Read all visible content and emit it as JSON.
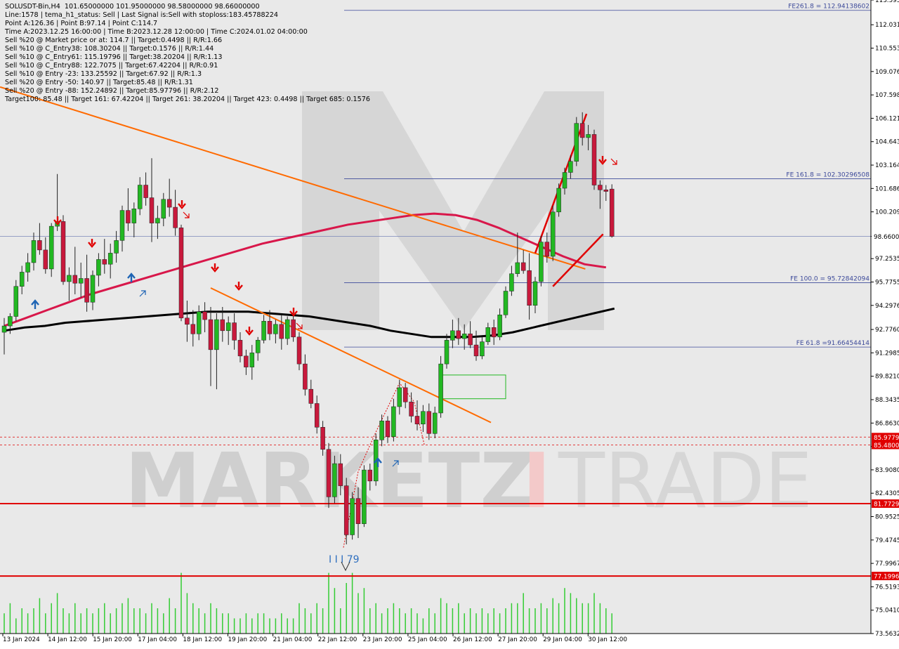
{
  "info": {
    "lines": [
      "SOLUSDT-Bin,H4  101.65000000 101.95000000 98.58000000 98.66000000",
      "Line:1578 | tema_h1_status: Sell | Last Signal is:Sell with stoploss:183.45788224",
      "Point A:126.36 | Point B:97.14 | Point C:114.7",
      "Time A:2023.12.25 16:00:00 | Time B:2023.12.28 12:00:00 | Time C:2024.01.02 04:00:00",
      "Sell %20 @ Market price or at: 114.7 || Target:0.4498 || R/R:1.66",
      "Sell %10 @ C_Entry38: 108.30204 || Target:0.1576 || R/R:1.44",
      "Sell %10 @ C_Entry61: 115.19796 || Target:38.20204 || R/R:1.13",
      "Sell %10 @ C_Entry88: 122.7075 || Target:67.42204 || R/R:0.91",
      "Sell %10 @ Entry -23: 133.25592 || Target:67.92 || R/R:1.3",
      "Sell %20 @ Entry -50: 140.97 || Target:85.48 || R/R:1.31",
      "Sell %20 @ Entry -88: 152.24892 || Target:85.97796 || R/R:2.12",
      "Target100: 85.48 || Target 161: 67.42204 || Target 261: 38.20204 || Target 423: 0.4498 || Target 685: 0.1576"
    ]
  },
  "watermark": {
    "left": "MARKETZ",
    "accent": "I",
    "right": "TRADE"
  },
  "colors": {
    "bull": "#22b822",
    "bear": "#c8193c",
    "wick": "#222222",
    "trend": "#ff6a00",
    "ma_red": "#d8174a",
    "ma_black": "#000000",
    "fib": "#3d4a9a",
    "support": "#e00000",
    "volume": "#33cc33",
    "arrow_sell": "#e00000",
    "arrow_buy": "#1e64b4"
  },
  "chart_data": {
    "type": "candlestick",
    "symbol": "SOLUSDT-Bin",
    "timeframe": "H4",
    "ylim": [
      73.5632,
      113.595
    ],
    "y_ticks": [
      "113.5950",
      "112.0310",
      "110.5535",
      "109.0760",
      "107.5985",
      "106.1210",
      "104.6435",
      "103.1640",
      "101.6865",
      "100.2090",
      "98.6600",
      "97.2535",
      "95.7755",
      "94.2976",
      "92.7760",
      "91.2985",
      "89.8210",
      "88.3435",
      "86.8630",
      "85.3855",
      "83.9080",
      "82.4305",
      "80.9525",
      "79.4745",
      "77.9967",
      "76.5193",
      "75.0410",
      "73.5632"
    ],
    "x_ticks": [
      "13 Jan 2024",
      "14 Jan 12:00",
      "15 Jan 20:00",
      "17 Jan 04:00",
      "18 Jan 12:00",
      "19 Jan 20:00",
      "21 Jan 04:00",
      "22 Jan 12:00",
      "23 Jan 20:00",
      "25 Jan 04:00",
      "26 Jan 12:00",
      "27 Jan 20:00",
      "29 Jan 04:00",
      "30 Jan 12:00"
    ],
    "ohlc": [
      [
        92.6,
        93.5,
        91.2,
        93.0
      ],
      [
        93.0,
        93.8,
        92.5,
        93.6
      ],
      [
        93.6,
        95.9,
        93.3,
        95.5
      ],
      [
        95.5,
        96.8,
        95.0,
        96.4
      ],
      [
        96.4,
        97.6,
        95.8,
        97.0
      ],
      [
        97.0,
        98.9,
        96.5,
        98.4
      ],
      [
        98.4,
        99.5,
        97.5,
        97.8
      ],
      [
        97.8,
        98.6,
        96.3,
        96.6
      ],
      [
        96.6,
        99.5,
        96.1,
        99.3
      ],
      [
        99.3,
        102.6,
        99.0,
        99.6
      ],
      [
        99.6,
        100.0,
        95.6,
        95.8
      ],
      [
        95.8,
        96.7,
        94.6,
        96.2
      ],
      [
        96.2,
        98.0,
        95.0,
        95.7
      ],
      [
        95.7,
        97.0,
        94.8,
        96.0
      ],
      [
        96.0,
        97.5,
        93.9,
        94.5
      ],
      [
        94.5,
        96.5,
        94.0,
        96.2
      ],
      [
        96.2,
        97.6,
        95.5,
        97.2
      ],
      [
        97.2,
        98.5,
        96.3,
        96.9
      ],
      [
        96.9,
        98.2,
        96.0,
        97.6
      ],
      [
        97.6,
        99.0,
        97.0,
        98.4
      ],
      [
        98.4,
        100.6,
        97.7,
        100.3
      ],
      [
        100.3,
        101.7,
        99.0,
        99.5
      ],
      [
        99.5,
        100.8,
        98.6,
        100.4
      ],
      [
        100.4,
        102.4,
        100.0,
        101.9
      ],
      [
        101.9,
        102.7,
        100.6,
        101.1
      ],
      [
        101.1,
        103.6,
        98.3,
        99.5
      ],
      [
        99.5,
        100.6,
        98.5,
        99.8
      ],
      [
        99.8,
        101.4,
        99.3,
        101.0
      ],
      [
        101.0,
        102.3,
        99.9,
        100.5
      ],
      [
        100.5,
        101.6,
        98.7,
        99.2
      ],
      [
        99.2,
        99.4,
        93.3,
        93.5
      ],
      [
        93.5,
        94.6,
        92.0,
        93.1
      ],
      [
        93.1,
        94.0,
        91.7,
        92.5
      ],
      [
        92.5,
        94.3,
        92.1,
        93.9
      ],
      [
        93.9,
        94.5,
        92.6,
        93.4
      ],
      [
        93.4,
        94.2,
        89.2,
        91.5
      ],
      [
        91.5,
        93.8,
        89.0,
        93.4
      ],
      [
        93.4,
        94.2,
        92.0,
        92.7
      ],
      [
        92.7,
        93.6,
        91.8,
        93.2
      ],
      [
        93.2,
        93.8,
        91.5,
        92.1
      ],
      [
        92.1,
        92.6,
        90.7,
        91.1
      ],
      [
        91.1,
        91.5,
        89.9,
        90.4
      ],
      [
        90.4,
        91.8,
        89.6,
        91.3
      ],
      [
        91.3,
        92.3,
        90.8,
        92.1
      ],
      [
        92.1,
        93.7,
        91.9,
        93.3
      ],
      [
        93.3,
        94.0,
        92.1,
        92.5
      ],
      [
        92.5,
        93.4,
        91.9,
        93.1
      ],
      [
        93.1,
        93.7,
        91.5,
        92.2
      ],
      [
        92.2,
        93.6,
        91.8,
        93.4
      ],
      [
        93.4,
        93.8,
        92.0,
        92.3
      ],
      [
        92.3,
        92.6,
        90.2,
        90.6
      ],
      [
        90.6,
        91.2,
        88.6,
        89.0
      ],
      [
        89.0,
        89.6,
        87.8,
        88.1
      ],
      [
        88.1,
        88.6,
        86.2,
        86.6
      ],
      [
        86.6,
        87.0,
        84.8,
        85.2
      ],
      [
        85.2,
        85.6,
        81.5,
        82.2
      ],
      [
        82.2,
        84.8,
        81.8,
        84.3
      ],
      [
        84.3,
        84.9,
        82.3,
        82.9
      ],
      [
        82.9,
        83.4,
        79.2,
        79.8
      ],
      [
        79.8,
        82.5,
        79.5,
        82.1
      ],
      [
        82.1,
        82.8,
        79.6,
        80.5
      ],
      [
        80.5,
        84.2,
        80.3,
        83.9
      ],
      [
        83.9,
        84.3,
        82.6,
        83.2
      ],
      [
        83.2,
        86.2,
        82.9,
        85.8
      ],
      [
        85.8,
        87.4,
        85.4,
        87.0
      ],
      [
        87.0,
        87.3,
        85.6,
        86.0
      ],
      [
        86.0,
        88.4,
        85.7,
        87.9
      ],
      [
        87.9,
        89.6,
        87.4,
        89.1
      ],
      [
        89.1,
        89.4,
        87.8,
        88.2
      ],
      [
        88.2,
        88.8,
        86.9,
        87.3
      ],
      [
        87.3,
        88.3,
        86.4,
        86.8
      ],
      [
        86.8,
        88.0,
        86.3,
        87.6
      ],
      [
        87.6,
        88.1,
        85.8,
        86.2
      ],
      [
        86.2,
        87.9,
        85.9,
        87.5
      ],
      [
        87.5,
        91.1,
        87.2,
        90.6
      ],
      [
        90.6,
        92.5,
        90.3,
        92.1
      ],
      [
        92.1,
        93.4,
        91.6,
        92.7
      ],
      [
        92.7,
        93.5,
        91.8,
        92.2
      ],
      [
        92.2,
        93.1,
        91.5,
        92.5
      ],
      [
        92.5,
        93.3,
        91.6,
        91.8
      ],
      [
        91.8,
        92.7,
        90.8,
        91.1
      ],
      [
        91.1,
        92.3,
        90.9,
        92.0
      ],
      [
        92.0,
        93.2,
        91.8,
        92.9
      ],
      [
        92.9,
        93.4,
        91.8,
        92.3
      ],
      [
        92.3,
        94.1,
        92.1,
        93.7
      ],
      [
        93.7,
        95.5,
        93.5,
        95.2
      ],
      [
        95.2,
        96.8,
        94.9,
        96.3
      ],
      [
        96.3,
        98.9,
        96.1,
        97.0
      ],
      [
        97.0,
        97.8,
        96.3,
        96.5
      ],
      [
        96.5,
        97.6,
        93.4,
        94.3
      ],
      [
        94.3,
        96.1,
        93.8,
        95.8
      ],
      [
        95.8,
        98.7,
        95.5,
        98.3
      ],
      [
        98.3,
        98.9,
        97.0,
        97.4
      ],
      [
        97.4,
        100.6,
        97.1,
        100.2
      ],
      [
        100.2,
        102.0,
        99.9,
        101.7
      ],
      [
        101.7,
        103.0,
        101.3,
        102.7
      ],
      [
        102.7,
        103.8,
        102.3,
        103.4
      ],
      [
        103.4,
        106.2,
        103.1,
        105.8
      ],
      [
        105.8,
        106.5,
        104.4,
        104.9
      ],
      [
        104.9,
        105.7,
        104.1,
        105.1
      ],
      [
        105.1,
        105.4,
        101.6,
        101.9
      ],
      [
        101.9,
        102.2,
        100.4,
        101.6
      ],
      [
        101.6,
        101.9,
        100.9,
        101.5
      ],
      [
        101.65,
        101.95,
        98.58,
        98.66
      ]
    ],
    "volume": [
      4,
      6,
      3,
      5,
      4,
      5,
      7,
      4,
      6,
      8,
      5,
      4,
      6,
      4,
      5,
      4,
      5,
      6,
      4,
      5,
      6,
      7,
      5,
      5,
      4,
      6,
      5,
      4,
      7,
      5,
      12,
      8,
      6,
      5,
      4,
      6,
      5,
      4,
      4,
      3,
      3,
      4,
      3,
      4,
      4,
      3,
      3,
      4,
      3,
      3,
      6,
      5,
      4,
      6,
      5,
      12,
      9,
      5,
      10,
      12,
      8,
      9,
      5,
      6,
      4,
      5,
      6,
      5,
      4,
      5,
      4,
      3,
      5,
      4,
      7,
      6,
      5,
      6,
      4,
      5,
      4,
      5,
      4,
      5,
      4,
      5,
      6,
      6,
      8,
      5,
      5,
      6,
      5,
      7,
      6,
      9,
      8,
      7,
      6,
      6,
      8,
      6,
      5,
      4
    ],
    "ma_red": [
      93.0,
      93.5,
      94.0,
      94.5,
      95.0,
      95.4,
      95.8,
      96.2,
      96.6,
      97.0,
      97.4,
      97.8,
      98.2,
      98.5,
      98.8,
      99.1,
      99.4,
      99.6,
      99.8,
      100.0,
      100.1,
      100.0,
      99.7,
      99.2,
      98.6,
      98.0,
      97.4,
      96.9,
      96.7
    ],
    "ma_black": [
      92.7,
      92.9,
      93.0,
      93.2,
      93.3,
      93.4,
      93.5,
      93.6,
      93.7,
      93.8,
      93.9,
      93.9,
      93.9,
      93.8,
      93.7,
      93.6,
      93.4,
      93.2,
      93.0,
      92.7,
      92.5,
      92.3,
      92.3,
      92.3,
      92.4,
      92.6,
      92.9,
      93.2,
      93.5,
      93.8,
      94.1
    ],
    "levels": [
      {
        "label": "FE261.8 = 112.94138602",
        "value": 112.94138602,
        "kind": "fib"
      },
      {
        "label": "FE 161.8 = 102.30296508",
        "value": 102.30296508,
        "kind": "fib"
      },
      {
        "label": "FE 100.0 = 95.72842094",
        "value": 95.72842094,
        "kind": "fib"
      },
      {
        "label": "FE 61.8 =91.66454414",
        "value": 91.66454414,
        "kind": "fib"
      }
    ],
    "current_price": {
      "value": 98.66,
      "label": "98.6600"
    },
    "support_lines": [
      {
        "value": 81.7729,
        "label": "81.7729"
      },
      {
        "value": 77.1996,
        "label": "77.1996"
      }
    ],
    "dotted_lines": [
      {
        "value": 85.9779,
        "label": "85.9779"
      },
      {
        "value": 85.48,
        "label": "85.4800"
      }
    ],
    "pattern_label": "I I I 79",
    "zone": {
      "from_index": 74,
      "to_index": 85,
      "y_top": 89.9,
      "y_bottom": 88.4
    }
  }
}
